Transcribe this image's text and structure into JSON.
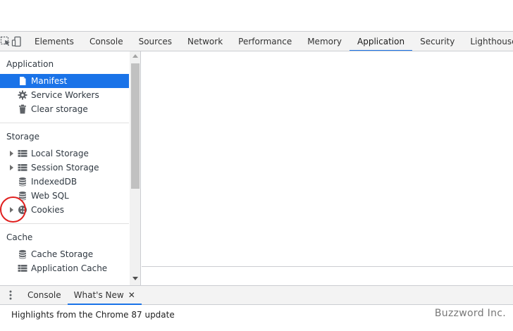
{
  "toolbar": {
    "tabs": [
      {
        "label": "Elements"
      },
      {
        "label": "Console"
      },
      {
        "label": "Sources"
      },
      {
        "label": "Network"
      },
      {
        "label": "Performance"
      },
      {
        "label": "Memory"
      },
      {
        "label": "Application",
        "selected": true
      },
      {
        "label": "Security"
      },
      {
        "label": "Lighthouse"
      }
    ]
  },
  "sidebar": {
    "application_header": "Application",
    "application_items": [
      {
        "label": "Manifest",
        "icon": "file-icon",
        "selected": true
      },
      {
        "label": "Service Workers",
        "icon": "gear-icon"
      },
      {
        "label": "Clear storage",
        "icon": "trash-icon"
      }
    ],
    "storage_header": "Storage",
    "storage_items": [
      {
        "label": "Local Storage",
        "icon": "grid-icon",
        "expandable": true
      },
      {
        "label": "Session Storage",
        "icon": "grid-icon",
        "expandable": true
      },
      {
        "label": "IndexedDB",
        "icon": "database-icon"
      },
      {
        "label": "Web SQL",
        "icon": "database-icon"
      },
      {
        "label": "Cookies",
        "icon": "cookie-icon",
        "expandable": true
      }
    ],
    "cache_header": "Cache",
    "cache_items": [
      {
        "label": "Cache Storage",
        "icon": "database-icon"
      },
      {
        "label": "Application Cache",
        "icon": "grid-icon"
      }
    ]
  },
  "drawer": {
    "tabs": [
      {
        "label": "Console"
      },
      {
        "label": "What's New",
        "selected": true,
        "closable": true
      }
    ],
    "close_glyph": "✕",
    "highlights_text": "Highlights from the Chrome 87 update",
    "watermark": "Buzzword Inc."
  },
  "colors": {
    "accent": "#1a73e8",
    "annotation": "#e0201f"
  }
}
